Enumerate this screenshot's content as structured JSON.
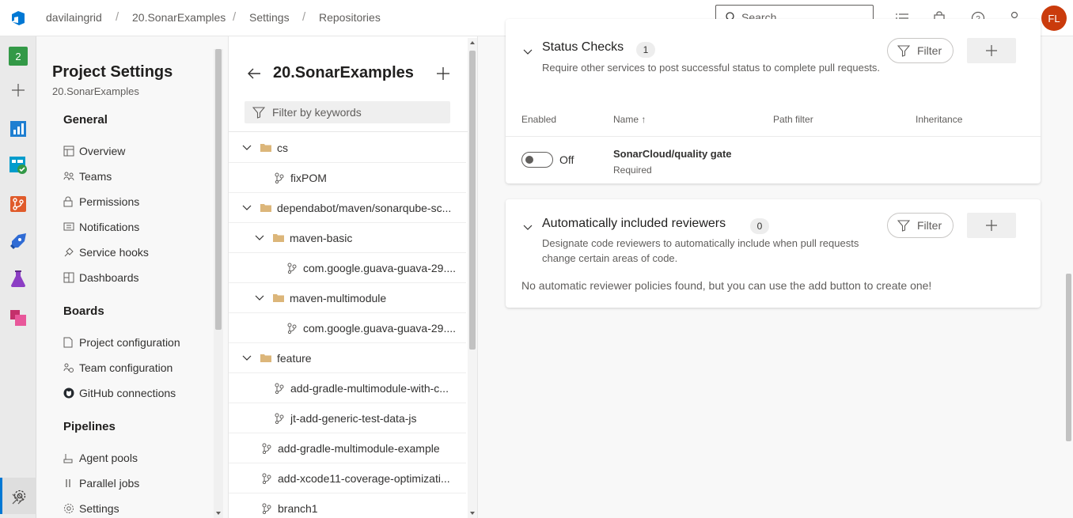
{
  "breadcrumbs": [
    "davilaingrid",
    "20.SonarExamples",
    "Settings",
    "Repositories"
  ],
  "search": {
    "placeholder": "Search"
  },
  "user": {
    "initials": "FL"
  },
  "rail": {
    "badge": "2"
  },
  "nav": {
    "title": "Project Settings",
    "subtitle": "20.SonarExamples",
    "groups": [
      {
        "label": "General",
        "items": [
          "Overview",
          "Teams",
          "Permissions",
          "Notifications",
          "Service hooks",
          "Dashboards"
        ]
      },
      {
        "label": "Boards",
        "items": [
          "Project configuration",
          "Team configuration",
          "GitHub connections"
        ]
      },
      {
        "label": "Pipelines",
        "items": [
          "Agent pools",
          "Parallel jobs",
          "Settings"
        ]
      }
    ]
  },
  "tree": {
    "title": "20.SonarExamples",
    "filter_placeholder": "Filter by keywords",
    "rows": [
      {
        "label": "cs",
        "kind": "folder"
      },
      {
        "label": "fixPOM",
        "kind": "branch"
      },
      {
        "label": "dependabot/maven/sonarqube-sc...",
        "kind": "folder"
      },
      {
        "label": "maven-basic",
        "kind": "folder"
      },
      {
        "label": "com.google.guava-guava-29....",
        "kind": "branch"
      },
      {
        "label": "maven-multimodule",
        "kind": "folder"
      },
      {
        "label": "com.google.guava-guava-29....",
        "kind": "branch"
      },
      {
        "label": "feature",
        "kind": "folder"
      },
      {
        "label": "add-gradle-multimodule-with-c...",
        "kind": "branch"
      },
      {
        "label": "jt-add-generic-test-data-js",
        "kind": "branch"
      },
      {
        "label": "add-gradle-multimodule-example",
        "kind": "branch"
      },
      {
        "label": "add-xcode11-coverage-optimizati...",
        "kind": "branch"
      },
      {
        "label": "branch1",
        "kind": "branch"
      }
    ]
  },
  "status_checks": {
    "title": "Status Checks",
    "count": "1",
    "description": "Require other services to post successful status to complete pull requests.",
    "filter_label": "Filter",
    "columns": [
      "Enabled",
      "Name ↑",
      "Path filter",
      "Inheritance"
    ],
    "row": {
      "toggle_state": "Off",
      "name": "SonarCloud/quality gate",
      "note": "Required"
    }
  },
  "reviewers": {
    "title": "Automatically included reviewers",
    "count": "0",
    "description": "Designate code reviewers to automatically include when pull requests change certain areas of code.",
    "filter_label": "Filter",
    "empty_text": "No automatic reviewer policies found, but you can use the add button to create one!"
  },
  "colors": {
    "accent": "#0078d4",
    "avatar": "#ca3b0c"
  }
}
